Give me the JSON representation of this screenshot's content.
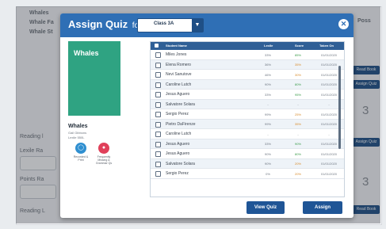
{
  "background": {
    "header_rows": [
      "Whales",
      "Whale Fa",
      "Whale St"
    ],
    "right_header": "Poss",
    "side_labels": [
      "Reading l",
      "Lexile Ra",
      "Points Ra",
      "Reading L"
    ],
    "right_buttons": [
      "Read Book",
      "Assign Quiz",
      "Assign Quiz",
      "Read Book"
    ],
    "right_numbers": [
      "3",
      "3",
      "3"
    ]
  },
  "modal": {
    "title": "Assign Quiz",
    "title_for": "for",
    "class_select": "Class 3A",
    "close_icon": "close-icon"
  },
  "book": {
    "cover_title": "Whales",
    "title": "Whales",
    "author": "Gail Gibbons",
    "lexile": "Lexile 550L",
    "actions": [
      {
        "label": "Recorded & Print",
        "color": "#2f8fd0",
        "icon": "headphones-icon"
      },
      {
        "label": "Frequently Missing & Grammar Qs",
        "color": "#e0405a",
        "icon": "person-icon"
      }
    ]
  },
  "table": {
    "headers": {
      "name": "Student Name",
      "lexile": "Lexile",
      "score": "Score",
      "taken": "Taken On"
    },
    "rows": [
      {
        "name": "Miles Jones",
        "lexile": "33%",
        "score": "85%",
        "taken": "01/01/2020",
        "color": "g"
      },
      {
        "name": "Elena Romero",
        "lexile": "36%",
        "score": "35%",
        "taken": "01/01/2020",
        "color": "o"
      },
      {
        "name": "Nevi Sanutove",
        "lexile": "46%",
        "score": "30%",
        "taken": "01/01/2020",
        "color": "o"
      },
      {
        "name": "Caroline Lutch",
        "lexile": "90%",
        "score": "80%",
        "taken": "01/01/2020",
        "color": "g"
      },
      {
        "name": "Jesus Aguero",
        "lexile": "33%",
        "score": "95%",
        "taken": "01/01/2020",
        "color": "g"
      },
      {
        "name": "Salvatore Solara",
        "lexile": "-",
        "score": "-",
        "taken": "-",
        "color": "n"
      },
      {
        "name": "Sergio Perez",
        "lexile": "99%",
        "score": "25%",
        "taken": "01/01/2020",
        "color": "o"
      },
      {
        "name": "Pietro DaFirenze",
        "lexile": "99%",
        "score": "35%",
        "taken": "01/01/2020",
        "color": "o"
      },
      {
        "name": "Caroline Lutch",
        "lexile": "-",
        "score": "-",
        "taken": "-",
        "color": "n"
      },
      {
        "name": "Jesus Aguero",
        "lexile": "33%",
        "score": "90%",
        "taken": "01/01/2020",
        "color": "g"
      },
      {
        "name": "Jesus Aguero",
        "lexile": "90%",
        "score": "80%",
        "taken": "01/01/2020",
        "color": "g"
      },
      {
        "name": "Salvatore Solara",
        "lexile": "90%",
        "score": "20%",
        "taken": "01/01/2020",
        "color": "o"
      },
      {
        "name": "Sergio Perez",
        "lexile": "0%",
        "score": "20%",
        "taken": "01/01/2020",
        "color": "o"
      }
    ]
  },
  "buttons": {
    "view_quiz": "View Quiz",
    "assign": "Assign"
  },
  "colors": {
    "header_blue": "#2f6fb5",
    "table_header": "#2f5f96",
    "button_blue": "#1f5596",
    "cover_green": "#2fa382"
  }
}
